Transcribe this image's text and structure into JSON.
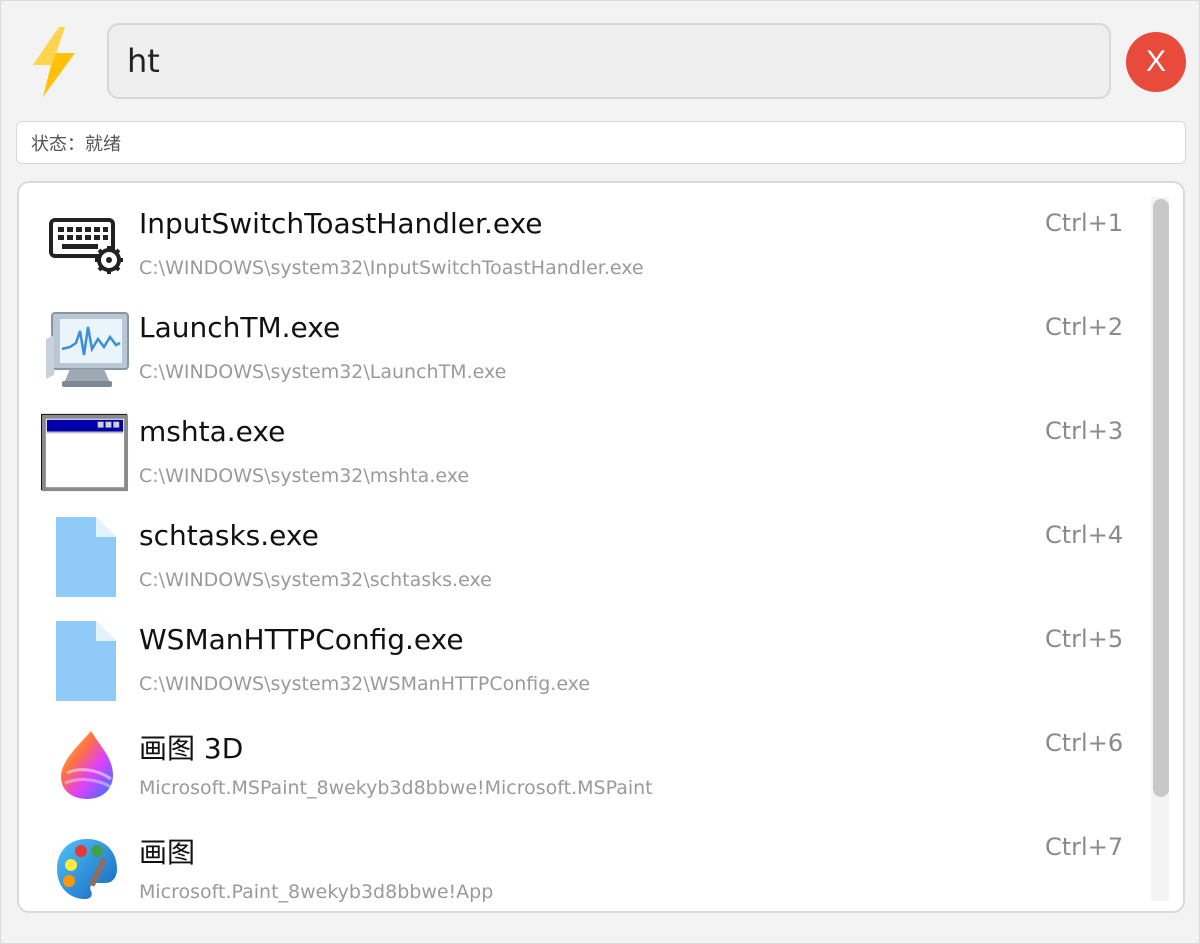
{
  "search": {
    "query": "ht"
  },
  "close_button": {
    "label": "X"
  },
  "status": {
    "text": "状态：就绪"
  },
  "results": [
    {
      "title": "InputSwitchToastHandler.exe",
      "path": "C:\\WINDOWS\\system32\\InputSwitchToastHandler.exe",
      "shortcut": "Ctrl+1",
      "icon": "keyboard-settings-icon"
    },
    {
      "title": "LaunchTM.exe",
      "path": "C:\\WINDOWS\\system32\\LaunchTM.exe",
      "shortcut": "Ctrl+2",
      "icon": "task-manager-icon"
    },
    {
      "title": "mshta.exe",
      "path": "C:\\WINDOWS\\system32\\mshta.exe",
      "shortcut": "Ctrl+3",
      "icon": "window-app-icon"
    },
    {
      "title": "schtasks.exe",
      "path": "C:\\WINDOWS\\system32\\schtasks.exe",
      "shortcut": "Ctrl+4",
      "icon": "file-icon"
    },
    {
      "title": "WSManHTTPConfig.exe",
      "path": "C:\\WINDOWS\\system32\\WSManHTTPConfig.exe",
      "shortcut": "Ctrl+5",
      "icon": "file-icon"
    },
    {
      "title": "画图 3D",
      "path": "Microsoft.MSPaint_8wekyb3d8bbwe!Microsoft.MSPaint",
      "shortcut": "Ctrl+6",
      "icon": "paint-3d-icon"
    },
    {
      "title": "画图",
      "path": "Microsoft.Paint_8wekyb3d8bbwe!App",
      "shortcut": "Ctrl+7",
      "icon": "paint-palette-icon"
    }
  ],
  "colors": {
    "close_button": "#e84a3c",
    "file_icon": "#90caf9",
    "accent_lightning": "#ffc107"
  }
}
